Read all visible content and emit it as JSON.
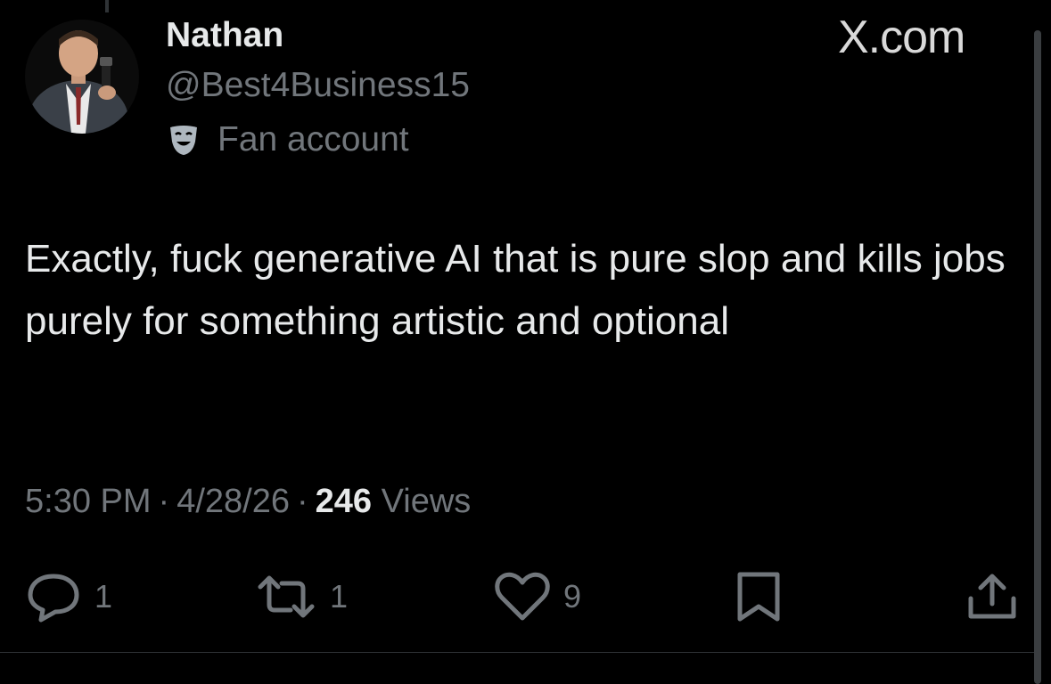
{
  "watermark": "X.com",
  "author": {
    "display_name": "Nathan",
    "handle": "@Best4Business15",
    "label": "Fan account",
    "label_icon": "theater-mask-icon",
    "avatar": "avatar-photo"
  },
  "tweet": {
    "text": "Exactly, fuck generative AI that is pure slop and kills jobs purely for something artistic and optional"
  },
  "meta": {
    "time": "5:30 PM",
    "date": "4/28/26",
    "separator": "·",
    "views_count": "246",
    "views_label": "Views"
  },
  "actions": {
    "reply": {
      "icon": "reply-icon",
      "count": "1"
    },
    "repost": {
      "icon": "repost-icon",
      "count": "1"
    },
    "like": {
      "icon": "heart-icon",
      "count": "9"
    },
    "bookmark": {
      "icon": "bookmark-icon"
    },
    "share": {
      "icon": "share-icon"
    }
  },
  "colors": {
    "background": "#000000",
    "primary_text": "#e7e9ea",
    "secondary_text": "#71767b"
  }
}
